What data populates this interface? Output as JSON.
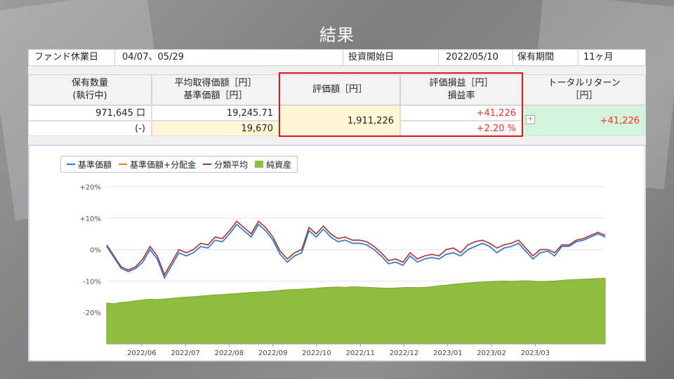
{
  "title": "結果",
  "info": {
    "holiday_label": "ファンド休業日",
    "holiday_value": "04/07、05/29",
    "start_label": "投資開始日",
    "start_value": "2022/05/10",
    "period_label": "保有期間",
    "period_value": "11ヶ月"
  },
  "table": {
    "headers": {
      "qty": [
        "保有数量",
        "(執行中)"
      ],
      "avg": [
        "平均取得価額［円］",
        "基準価額［円］"
      ],
      "eval": "評価額［円］",
      "pl": [
        "評価損益［円］",
        "損益率"
      ],
      "total": [
        "トータルリターン",
        "［円］"
      ]
    },
    "qty": "971,645 口",
    "qty_pending": "(-)",
    "avg_cost": "19,245.71",
    "nav": "19,670",
    "eval_value": "1,911,226",
    "pl_value": "+41,226",
    "pl_rate": "+2.20 %",
    "total_return": "+41,226"
  },
  "colors": {
    "nav": "#2a7bd8",
    "nav_dist": "#f07a2c",
    "installment_avg": "#a83232",
    "net_assets": "#8fbd3d",
    "highlight": "#e2121a",
    "positive": "#ff2a2a"
  },
  "chart_data": {
    "type": "line",
    "series": [
      {
        "name": "基準価額",
        "y": [
          1.0,
          -2.5,
          -6.0,
          -7.0,
          -6.0,
          -4.0,
          0.0,
          -3.0,
          -9.0,
          -5.0,
          -1.0,
          -2.0,
          -1.0,
          1.0,
          0.5,
          3.0,
          2.5,
          5.0,
          8.0,
          6.0,
          4.0,
          8.0,
          6.0,
          3.0,
          -1.5,
          -4.0,
          -2.0,
          -1.0,
          6.0,
          4.0,
          6.5,
          4.0,
          2.5,
          3.0,
          2.0,
          2.0,
          1.5,
          0.0,
          -2.0,
          -4.5,
          -4.0,
          -5.0,
          -2.0,
          -4.0,
          -3.0,
          -2.5,
          -3.0,
          -1.5,
          -1.0,
          -2.0,
          0.0,
          1.0,
          2.0,
          1.0,
          -1.0,
          0.5,
          1.0,
          2.0,
          -0.5,
          -3.0,
          -1.0,
          -0.5,
          -2.0,
          1.0,
          1.0,
          2.5,
          3.0,
          4.0,
          5.0,
          4.0
        ]
      },
      {
        "name": "基準価額+分配金",
        "y": [
          1.0,
          -2.5,
          -6.0,
          -7.0,
          -6.0,
          -4.0,
          0.0,
          -3.0,
          -9.0,
          -5.0,
          -1.0,
          -2.0,
          -1.0,
          1.0,
          0.5,
          3.0,
          2.5,
          5.0,
          8.0,
          6.0,
          4.0,
          8.0,
          6.0,
          3.0,
          -1.5,
          -4.0,
          -2.0,
          -1.0,
          6.0,
          4.0,
          6.5,
          4.0,
          2.5,
          3.0,
          2.0,
          2.0,
          1.5,
          0.0,
          -2.0,
          -4.5,
          -4.0,
          -5.0,
          -2.0,
          -4.0,
          -3.0,
          -2.5,
          -3.0,
          -1.5,
          -1.0,
          -2.0,
          0.0,
          1.0,
          2.0,
          1.0,
          -1.0,
          0.5,
          1.0,
          2.0,
          -0.5,
          -3.0,
          -1.0,
          -0.5,
          -2.0,
          1.0,
          1.0,
          2.5,
          3.0,
          4.0,
          5.0,
          4.0
        ]
      },
      {
        "name": "分類平均",
        "y": [
          1.5,
          -2.0,
          -5.5,
          -6.5,
          -5.5,
          -3.0,
          1.0,
          -2.0,
          -8.0,
          -4.0,
          0.0,
          -1.0,
          0.0,
          2.0,
          1.5,
          4.0,
          3.5,
          6.0,
          9.0,
          7.0,
          5.0,
          9.0,
          7.0,
          4.0,
          -0.5,
          -3.0,
          -1.0,
          0.0,
          7.0,
          5.0,
          7.5,
          5.0,
          3.5,
          4.0,
          3.0,
          3.0,
          2.5,
          1.0,
          -1.0,
          -3.5,
          -3.0,
          -4.0,
          -1.0,
          -3.0,
          -2.0,
          -1.5,
          -2.0,
          0.0,
          0.5,
          -1.0,
          1.5,
          2.5,
          3.0,
          2.0,
          0.5,
          1.5,
          2.0,
          3.0,
          0.5,
          -2.0,
          0.0,
          0.0,
          -1.0,
          1.5,
          1.5,
          3.0,
          3.5,
          4.5,
          5.5,
          4.5
        ]
      },
      {
        "name": "純資産",
        "y": [
          -17.0,
          -17.2,
          -16.8,
          -16.6,
          -16.3,
          -16.0,
          -15.8,
          -15.9,
          -15.7,
          -15.5,
          -15.3,
          -15.1,
          -15.0,
          -14.8,
          -14.6,
          -14.4,
          -14.3,
          -14.1,
          -14.0,
          -13.8,
          -13.6,
          -13.5,
          -13.4,
          -13.2,
          -13.0,
          -12.8,
          -12.7,
          -12.6,
          -12.4,
          -12.3,
          -12.1,
          -12.0,
          -11.9,
          -12.0,
          -11.8,
          -11.9,
          -12.0,
          -12.1,
          -12.2,
          -12.3,
          -12.2,
          -12.1,
          -12.0,
          -12.1,
          -12.0,
          -11.8,
          -11.5,
          -11.3,
          -11.0,
          -10.8,
          -10.6,
          -10.4,
          -10.3,
          -10.2,
          -10.1,
          -10.0,
          -10.1,
          -10.0,
          -9.9,
          -10.0,
          -10.2,
          -10.1,
          -10.0,
          -9.8,
          -9.6,
          -9.5,
          -9.4,
          -9.3,
          -9.2,
          -9.1
        ]
      }
    ],
    "xlabels": [
      "2022/06",
      "2022/07",
      "2022/08",
      "2022/09",
      "2022/10",
      "2022/11",
      "2022/12",
      "2023/01",
      "2023/02",
      "2023/03"
    ],
    "ytick_labels": [
      "+20%",
      "+10%",
      "0%",
      "-10%",
      "-20%"
    ],
    "ylim": [
      -30,
      20
    ],
    "grid": true,
    "legend": "top-left"
  }
}
